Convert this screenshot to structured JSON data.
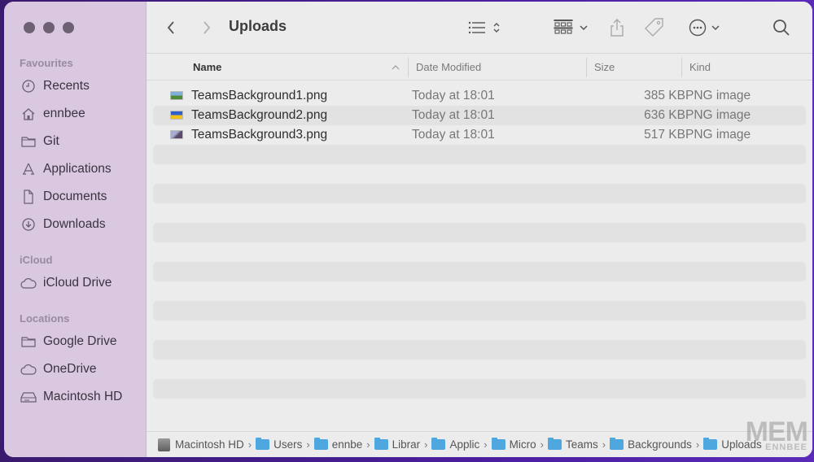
{
  "window": {
    "title": "Uploads"
  },
  "sidebar": {
    "sections": [
      {
        "label": "Favourites",
        "items": [
          {
            "label": "Recents",
            "icon": "clock-icon"
          },
          {
            "label": "ennbee",
            "icon": "home-icon"
          },
          {
            "label": "Git",
            "icon": "folder-icon"
          },
          {
            "label": "Applications",
            "icon": "applications-icon"
          },
          {
            "label": "Documents",
            "icon": "document-icon"
          },
          {
            "label": "Downloads",
            "icon": "download-icon"
          }
        ]
      },
      {
        "label": "iCloud",
        "items": [
          {
            "label": "iCloud Drive",
            "icon": "cloud-icon"
          }
        ]
      },
      {
        "label": "Locations",
        "items": [
          {
            "label": "Google Drive",
            "icon": "folder-icon"
          },
          {
            "label": "OneDrive",
            "icon": "cloud-icon"
          },
          {
            "label": "Macintosh HD",
            "icon": "disk-icon"
          }
        ]
      }
    ]
  },
  "columns": {
    "name": "Name",
    "date": "Date Modified",
    "size": "Size",
    "kind": "Kind"
  },
  "files": [
    {
      "name": "TeamsBackground1.png",
      "date": "Today at 18:01",
      "size": "385 KB",
      "kind": "PNG image",
      "thumb_colors": [
        "#7fb0d8",
        "#4d8a3a"
      ]
    },
    {
      "name": "TeamsBackground2.png",
      "date": "Today at 18:01",
      "size": "636 KB",
      "kind": "PNG image",
      "thumb_colors": [
        "#2f5fc8",
        "#f2c21a"
      ]
    },
    {
      "name": "TeamsBackground3.png",
      "date": "Today at 18:01",
      "size": "517 KB",
      "kind": "PNG image",
      "thumb_colors": [
        "#8a8fb8",
        "#5a4a6a"
      ]
    }
  ],
  "pathbar": [
    {
      "label": "Macintosh HD",
      "icon": "disk-icon"
    },
    {
      "label": "Users",
      "icon": "folder-icon"
    },
    {
      "label": "ennbe",
      "icon": "folder-icon"
    },
    {
      "label": "Librar",
      "icon": "folder-icon"
    },
    {
      "label": "Applic",
      "icon": "folder-icon"
    },
    {
      "label": "Micro",
      "icon": "folder-icon"
    },
    {
      "label": "Teams",
      "icon": "folder-icon"
    },
    {
      "label": "Backgrounds",
      "icon": "folder-icon"
    },
    {
      "label": "Uploads",
      "icon": "folder-icon"
    }
  ],
  "watermark": {
    "main": "MEM",
    "sub": "ENNBEE"
  }
}
